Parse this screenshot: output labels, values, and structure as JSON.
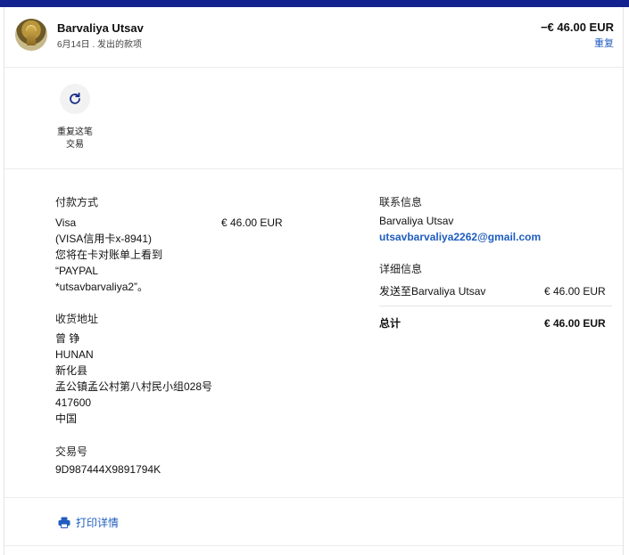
{
  "header": {
    "name": "Barvaliya Utsav",
    "subline": "6月14日 . 发出的款项",
    "amount": "−€ 46.00 EUR",
    "repeat_link": "重复"
  },
  "actions": {
    "repeat_label_line1": "重复这笔",
    "repeat_label_line2": "交易"
  },
  "payment": {
    "title": "付款方式",
    "method": "Visa",
    "amount": "€ 46.00 EUR",
    "card": "(VISA信用卡x-8941)",
    "statement_line1": "您将在卡对账单上看到",
    "statement_line2": "“PAYPAL",
    "statement_line3": "*utsavbarvaliya2”。"
  },
  "shipping": {
    "title": "收货地址",
    "lines": [
      "曾 铮",
      "HUNAN",
      "新化县",
      "孟公镇孟公村第八村民小组028号",
      "417600",
      "中国"
    ]
  },
  "transaction": {
    "title": "交易号",
    "id": "9D987444X9891794K"
  },
  "contact": {
    "title": "联系信息",
    "name": "Barvaliya Utsav",
    "email": "utsavbarvaliya2262@gmail.com"
  },
  "details": {
    "title": "详细信息",
    "sent_to": "发送至Barvaliya Utsav",
    "sent_amount": "€ 46.00 EUR",
    "total_label": "总计",
    "total_amount": "€ 46.00 EUR"
  },
  "footer": {
    "print_label": "打印详情"
  },
  "colors": {
    "topbar": "#12238f",
    "link": "#1f5dbf"
  },
  "icons": {
    "repeat": "refresh-icon",
    "print": "printer-icon"
  }
}
